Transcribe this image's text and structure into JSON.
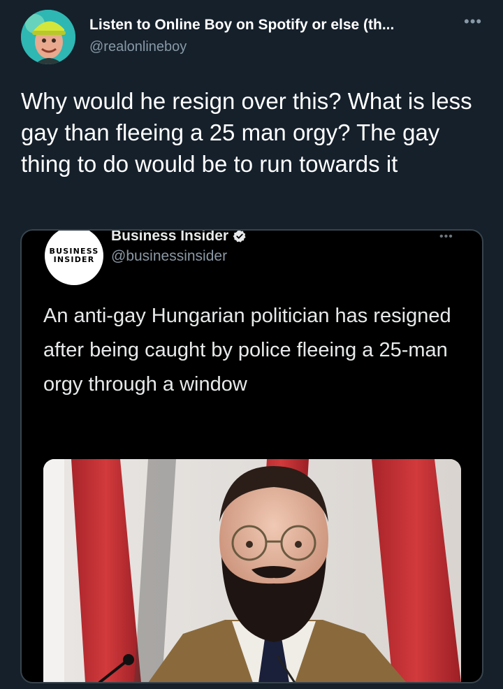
{
  "tweet": {
    "display_name": "Listen to Online Boy on Spotify or else (th...",
    "handle": "@realonlineboy",
    "text": "Why would he resign over this? What is less gay than fleeing a 25 man orgy? The gay thing to do would be to run towards it",
    "more_icon": "ellipsis-icon"
  },
  "embedded_tweet": {
    "logo_line1": "BUSINESS",
    "logo_line2": "INSIDER",
    "display_name": "Business Insider",
    "handle": "@businessinsider",
    "verified_icon": "verified-badge-icon",
    "text": "An anti-gay Hungarian politician has resigned after being caught by police fleeing a 25-man orgy through a window",
    "more_icon": "ellipsis-icon"
  },
  "colors": {
    "background": "#15202b",
    "secondary_text": "#8899a6",
    "embed_background": "#000000",
    "verified": "#1d9bf0"
  }
}
